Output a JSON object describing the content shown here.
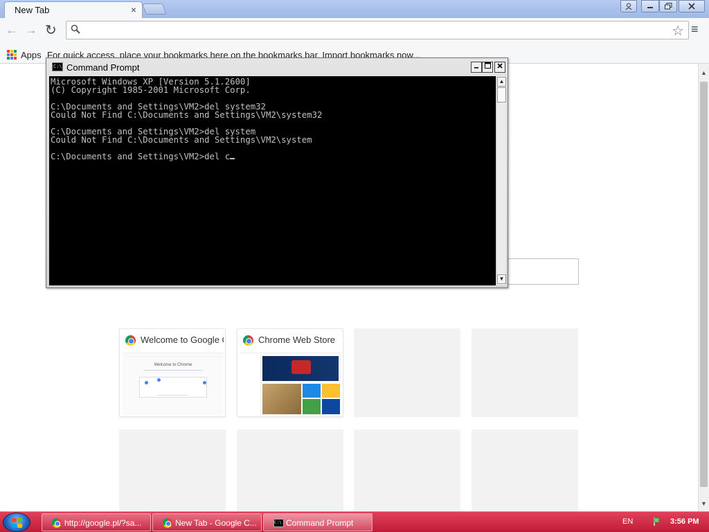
{
  "browser": {
    "tab_title": "New Tab",
    "tab_close": "×",
    "omnibox_value": "",
    "omnibox_placeholder": "",
    "bookmarks": {
      "apps_label": "Apps",
      "hint": "For quick access, place your bookmarks here on the bookmarks bar. Import bookmarks now..."
    },
    "icons": {
      "back": "back-arrow-icon",
      "forward": "forward-arrow-icon",
      "reload": "reload-icon",
      "search": "search-icon",
      "star": "star-icon",
      "menu": "hamburger-menu-icon"
    }
  },
  "tiles": [
    {
      "title": "Welcome to Google Chrome",
      "thumb_title": "Welcome to Chrome"
    },
    {
      "title": "Chrome Web Store"
    }
  ],
  "cmd": {
    "title": "Command Prompt",
    "icon_text": "C:\\",
    "lines": [
      "Microsoft Windows XP [Version 5.1.2600]",
      "(C) Copyright 1985-2001 Microsoft Corp.",
      "",
      "C:\\Documents and Settings\\VM2>del system32",
      "Could Not Find C:\\Documents and Settings\\VM2\\system32",
      "",
      "C:\\Documents and Settings\\VM2>del system",
      "Could Not Find C:\\Documents and Settings\\VM2\\system",
      "",
      "C:\\Documents and Settings\\VM2>del c"
    ]
  },
  "taskbar": {
    "items": [
      {
        "label": "http://google.pl/?sa...",
        "icon": "chrome-icon"
      },
      {
        "label": "New Tab - Google C...",
        "icon": "chrome-icon"
      },
      {
        "label": "Command Prompt",
        "icon": "cmd-icon"
      }
    ],
    "language": "EN",
    "clock": "3:56 PM"
  },
  "colors": {
    "taskbar": "#c01c38",
    "console_bg": "#000000",
    "console_text": "#c0c0c0"
  }
}
